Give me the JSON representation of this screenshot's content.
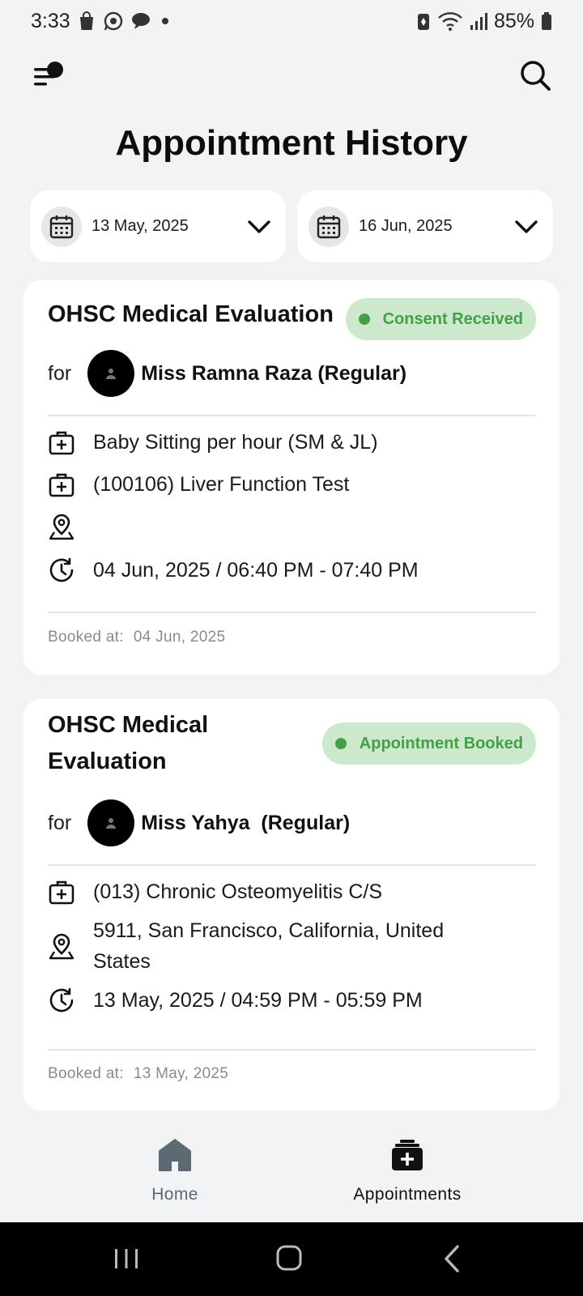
{
  "status_bar": {
    "time": "3:33",
    "battery_percent": "85%",
    "icons": [
      "shopping-bag-icon",
      "whatsapp-icon",
      "chat-icon",
      "dot-icon",
      "battery-saver-icon",
      "wifi-icon",
      "signal-icon",
      "battery-icon"
    ]
  },
  "header": {
    "menu_icon": "menu-notification-icon",
    "search_icon": "search-icon"
  },
  "page": {
    "title": "Appointment History"
  },
  "filters": {
    "from_date": "13 May, 2025",
    "to_date": "16 Jun, 2025"
  },
  "appointments": [
    {
      "title": "OHSC Medical Evaluation",
      "status": "Consent Received",
      "for_label": "for",
      "patient": "Miss Ramna Raza (Regular)",
      "services": [
        "Baby Sitting per hour (SM & JL)",
        "(100106) Liver Function Test"
      ],
      "location": "",
      "datetime": "04 Jun, 2025 / 06:40 PM - 07:40 PM",
      "booked_label": "Booked at:",
      "booked_at": "04 Jun, 2025"
    },
    {
      "title_line1": "OHSC Medical",
      "title_line2": "Evaluation",
      "status": "Appointment Booked",
      "for_label": "for",
      "patient": "Miss Yahya  (Regular)",
      "services": [
        "(013) Chronic Osteomyelitis C/S"
      ],
      "location_line1": "5911, San Francisco, California, United",
      "location_line2": "States",
      "datetime": "13 May, 2025 / 04:59 PM - 05:59 PM",
      "booked_label": "Booked at:",
      "booked_at": "13 May, 2025"
    }
  ],
  "bottom_nav": {
    "home_label": "Home",
    "appointments_label": "Appointments"
  },
  "colors": {
    "background": "#f2f3f5",
    "badge_bg": "#cde9cd",
    "badge_text": "#43a047",
    "home_icon": "#5c6b73"
  }
}
